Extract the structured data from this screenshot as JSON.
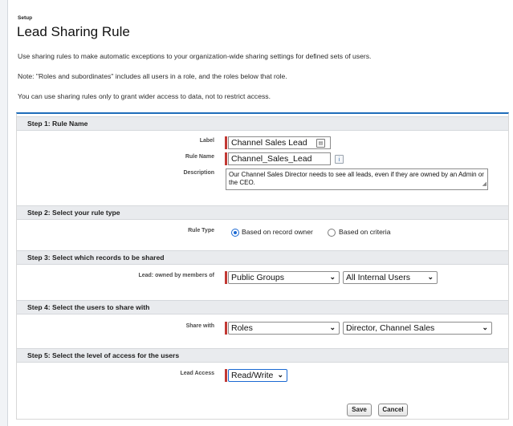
{
  "header": {
    "setup": "Setup",
    "title": "Lead Sharing Rule"
  },
  "info": [
    "Use sharing rules to make automatic exceptions to your organization-wide sharing settings for defined sets of users.",
    "Note: \"Roles and subordinates\" includes all users in a role, and the roles below that role.",
    "You can use sharing rules only to grant wider access to data, not to restrict access."
  ],
  "step1": {
    "title": "Step 1: Rule Name",
    "label_label": "Label",
    "label_value": "Channel Sales Lead",
    "rule_name_label": "Rule Name",
    "rule_name_value": "Channel_Sales_Lead",
    "description_label": "Description",
    "description_value": "Our Channel Sales Director needs to see all leads, even if they are owned by an Admin or the CEO."
  },
  "step2": {
    "title": "Step 2: Select your rule type",
    "rule_type_label": "Rule Type",
    "option_owner": "Based on record owner",
    "option_criteria": "Based on criteria",
    "selected": "owner"
  },
  "step3": {
    "title": "Step 3: Select which records to be shared",
    "label": "Lead: owned by members of",
    "group_type": "Public Groups",
    "group_value": "All Internal Users"
  },
  "step4": {
    "title": "Step 4: Select the users to share with",
    "label": "Share with",
    "share_type": "Roles",
    "share_value": "Director, Channel Sales"
  },
  "step5": {
    "title": "Step 5: Select the level of access for the users",
    "label": "Lead Access",
    "access_value": "Read/Write"
  },
  "buttons": {
    "save": "Save",
    "cancel": "Cancel"
  },
  "icons": {
    "info": "i",
    "chevron": "⌄"
  },
  "colors": {
    "required": "#c23934",
    "accent": "#1f6dba",
    "section_bg": "#e9ebee"
  }
}
